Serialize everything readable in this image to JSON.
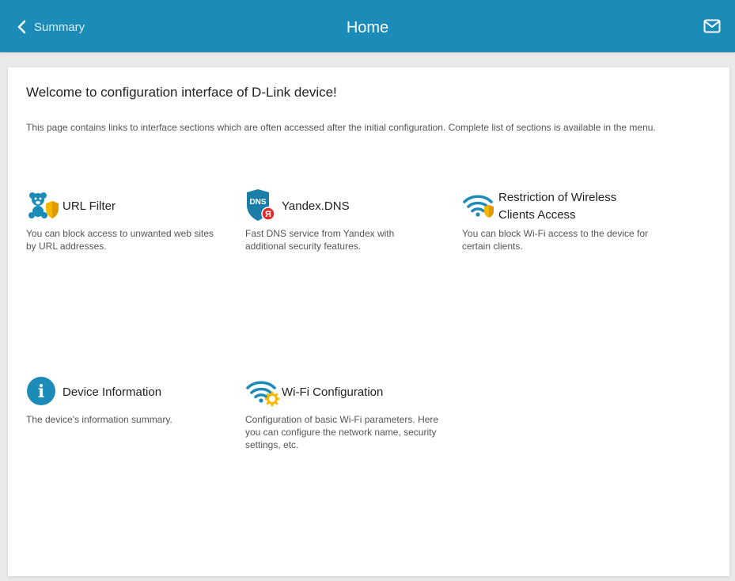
{
  "header": {
    "back_label": "Summary",
    "title": "Home",
    "accent_color": "#1b8cb8"
  },
  "main": {
    "welcome": "Welcome to configuration interface of D-Link device!",
    "intro": "This page contains links to interface sections which are often accessed after the initial configuration. Complete list of sections is available in the menu."
  },
  "cards": {
    "url_filter": {
      "title": "URL Filter",
      "description": "You can block access to unwanted web sites by URL addresses.",
      "icon": "teddy-bear-shield-icon"
    },
    "yandex_dns": {
      "title": "Yandex.DNS",
      "description": "Fast DNS service from Yandex with additional security features.",
      "icon_text": "DNS",
      "badge_text": "Я",
      "icon": "dns-shield-icon"
    },
    "wireless_restriction": {
      "title": "Restriction of Wireless Clients Access",
      "description": "You can block Wi-Fi access to the device for certain clients.",
      "icon": "wifi-shield-icon"
    },
    "device_info": {
      "title": "Device Information",
      "description": "The device's information summary.",
      "icon_text": "i",
      "icon": "info-icon"
    },
    "wifi_config": {
      "title": "Wi-Fi Configuration",
      "description": "Configuration of basic Wi-Fi parameters. Here you can configure the network name, security settings, etc.",
      "icon": "wifi-gear-icon"
    }
  }
}
